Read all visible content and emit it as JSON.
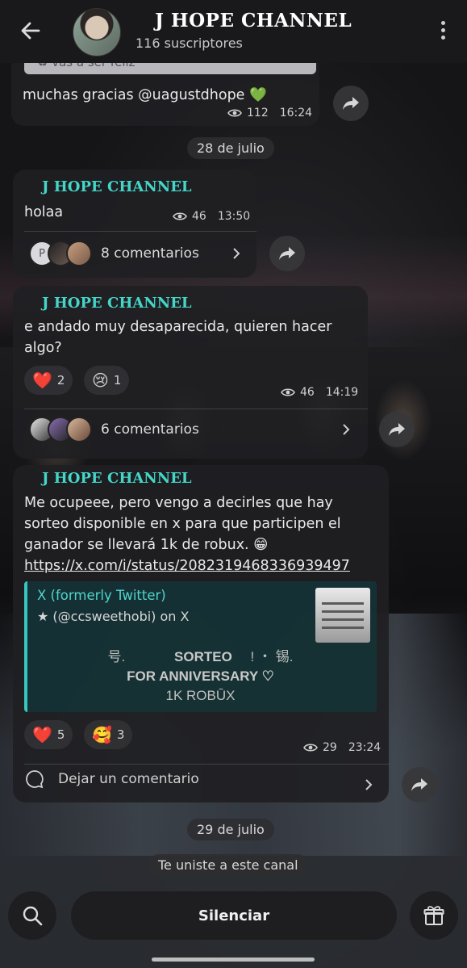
{
  "header": {
    "title": "J HOPE CHANNEL",
    "subscribers": "116 suscriptores"
  },
  "quoted_reply": "♻ vas a ser feliz",
  "msg1": {
    "text": "muchas gracias @uagustdhope 💚",
    "views": "112",
    "time": "16:24"
  },
  "date1": "28 de julio",
  "msg2": {
    "sender": "J HOPE CHANNEL",
    "text": "holaa",
    "views": "46",
    "time": "13:50",
    "comments": "8 comentarios",
    "avatar_letter": "P"
  },
  "msg3": {
    "sender": "J HOPE CHANNEL",
    "text_line1": "e andado muy desaparecida, quieren hacer",
    "text_line2": "algo?",
    "reactions": [
      {
        "emoji": "❤️",
        "count": "2"
      },
      {
        "emoji": "😢",
        "count": "1"
      }
    ],
    "views": "46",
    "time": "14:19",
    "comments": "6 comentarios"
  },
  "msg4": {
    "sender": "J HOPE CHANNEL",
    "text_line1": "Me ocupeee, pero vengo a decirles que hay",
    "text_line2": "sorteo disponible en x para que participen el",
    "text_line3": "ganador se llevará 1k de robux. 😁",
    "link": "https://x.com/i/status/2082319468336939497",
    "preview": {
      "site": "X (formerly Twitter)",
      "author": "★ (@ccsweethobi) on X",
      "line1_left": "号.",
      "line1_main": "SORTEO",
      "line1_right": "! ・ 锡.",
      "line2": "FOR ANNIVERSARY ♡",
      "line3": "1K ROBŪX"
    },
    "reactions": [
      {
        "emoji": "❤️",
        "count": "5"
      },
      {
        "emoji": "🥰",
        "count": "3"
      }
    ],
    "views": "29",
    "time": "23:24",
    "comment_placeholder": "Dejar un comentario"
  },
  "date2": "29 de julio",
  "system_msg": "Te uniste a este canal",
  "bottom": {
    "silence_label": "Silenciar"
  },
  "colors": {
    "accent": "#44d6c8",
    "bubble": "#202023",
    "header": "#19191b"
  }
}
